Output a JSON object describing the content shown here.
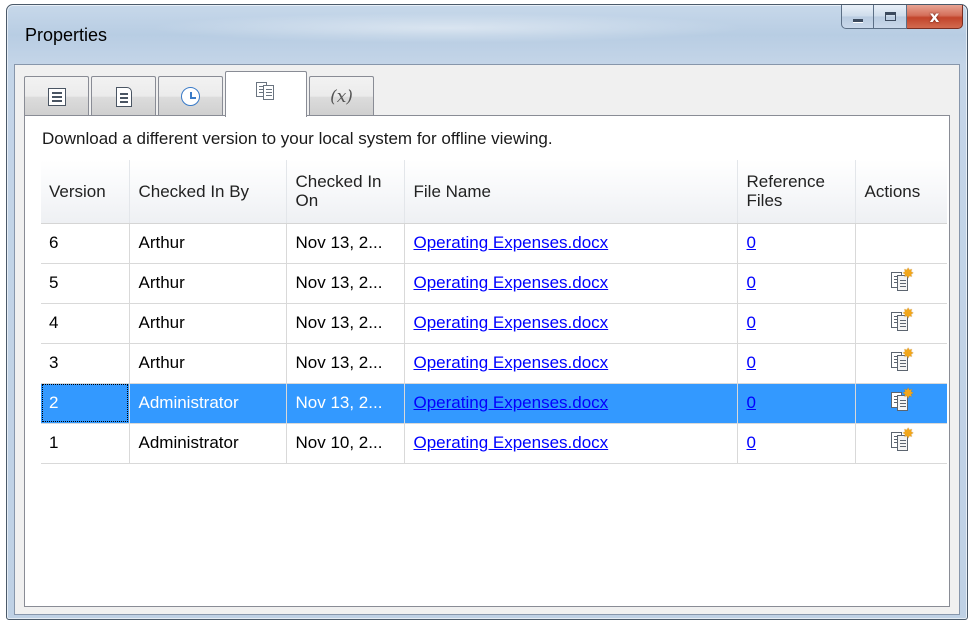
{
  "window": {
    "title": "Properties",
    "close_glyph": "x"
  },
  "tabs": [
    {
      "icon": "list-icon",
      "active": false
    },
    {
      "icon": "document-icon",
      "active": false
    },
    {
      "icon": "clock-icon",
      "active": false
    },
    {
      "icon": "versions-icon",
      "active": true
    },
    {
      "icon": "variables-icon",
      "label": "(x)",
      "active": false
    }
  ],
  "panel": {
    "description": "Download a different version to your local system for offline viewing."
  },
  "table": {
    "headers": {
      "version": "Version",
      "checked_in_by": "Checked In By",
      "checked_in_on": "Checked In On",
      "file_name": "File Name",
      "reference_files": "Reference Files",
      "actions": "Actions"
    },
    "rows": [
      {
        "version": "6",
        "checked_in_by": "Arthur",
        "checked_in_on": "Nov 13, 2...",
        "file_name": "Operating Expenses.docx",
        "reference_files": "0",
        "has_action": false,
        "selected": false
      },
      {
        "version": "5",
        "checked_in_by": "Arthur",
        "checked_in_on": "Nov 13, 2...",
        "file_name": "Operating Expenses.docx",
        "reference_files": "0",
        "has_action": true,
        "selected": false
      },
      {
        "version": "4",
        "checked_in_by": "Arthur",
        "checked_in_on": "Nov 13, 2...",
        "file_name": "Operating Expenses.docx",
        "reference_files": "0",
        "has_action": true,
        "selected": false
      },
      {
        "version": "3",
        "checked_in_by": "Arthur",
        "checked_in_on": "Nov 13, 2...",
        "file_name": "Operating Expenses.docx",
        "reference_files": "0",
        "has_action": true,
        "selected": false
      },
      {
        "version": "2",
        "checked_in_by": "Administrator",
        "checked_in_on": "Nov 13, 2...",
        "file_name": "Operating Expenses.docx",
        "reference_files": "0",
        "has_action": true,
        "selected": true
      },
      {
        "version": "1",
        "checked_in_by": "Administrator",
        "checked_in_on": "Nov 10, 2...",
        "file_name": "Operating Expenses.docx",
        "reference_files": "0",
        "has_action": true,
        "selected": false
      }
    ]
  },
  "colors": {
    "selection": "#3399ff",
    "link": "#0000ff"
  }
}
